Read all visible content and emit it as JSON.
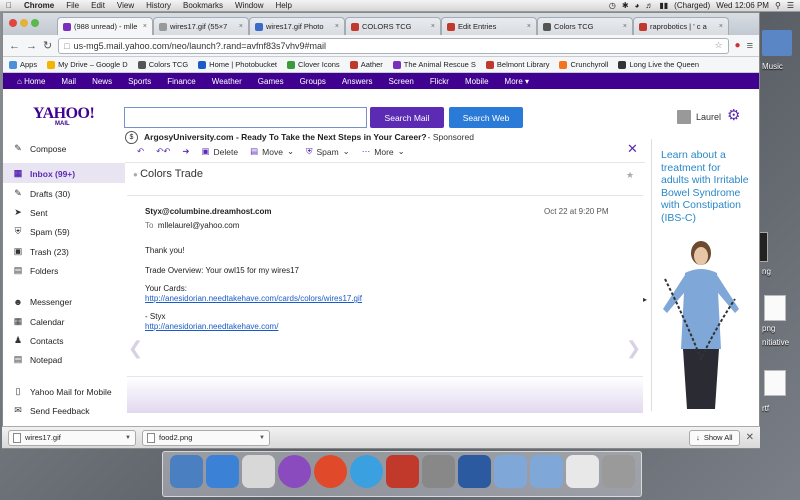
{
  "menubar": {
    "app_name": "Chrome",
    "items": [
      "File",
      "Edit",
      "View",
      "History",
      "Bookmarks",
      "Window",
      "Help"
    ],
    "battery": "(Charged)",
    "clock": "Wed 12:06 PM"
  },
  "desktop": {
    "icons": [
      "Music",
      "ng",
      "png",
      "nitiative",
      "rtf"
    ]
  },
  "tabs": [
    {
      "title": "(988 unread) - mlle",
      "active": true,
      "color": "#7b2fbf"
    },
    {
      "title": "wires17.gif (55×7",
      "active": false,
      "color": "#999999"
    },
    {
      "title": "wires17.gif Photo",
      "active": false,
      "color": "#3a6bc8"
    },
    {
      "title": "COLORS TCG",
      "active": false,
      "color": "#c0392b"
    },
    {
      "title": "Edit Entries",
      "active": false,
      "color": "#c0392b"
    },
    {
      "title": "Colors TCG",
      "active": false,
      "color": "#555555"
    },
    {
      "title": "raprobotics | ' c a",
      "active": false,
      "color": "#c0392b"
    }
  ],
  "omnibox": {
    "url": "us-mg5.mail.yahoo.com/neo/launch?.rand=avfnf83s7vhv9#mail"
  },
  "bookmarks": [
    {
      "label": "Apps",
      "color": "#4a90d9"
    },
    {
      "label": "My Drive – Google D",
      "color": "#f4b400"
    },
    {
      "label": "Colors TCG",
      "color": "#555555"
    },
    {
      "label": "Home | Photobucket",
      "color": "#1a5bc9"
    },
    {
      "label": "Clover Icons",
      "color": "#3a9b3a"
    },
    {
      "label": "Aather",
      "color": "#c0392b"
    },
    {
      "label": "The Animal Rescue S",
      "color": "#7b2fbf"
    },
    {
      "label": "Belmont Library",
      "color": "#c0392b"
    },
    {
      "label": "Crunchyroll",
      "color": "#f47521"
    },
    {
      "label": "Long Live the Queen",
      "color": "#333333"
    }
  ],
  "ynav": [
    "Home",
    "Mail",
    "News",
    "Sports",
    "Finance",
    "Weather",
    "Games",
    "Groups",
    "Answers",
    "Screen",
    "Flickr",
    "Mobile",
    "More ▾"
  ],
  "yheader": {
    "logo": "YAHOO!",
    "logo_sub": "MAIL",
    "search_placeholder": "",
    "search_mail": "Search Mail",
    "search_web": "Search Web",
    "user": "Laurel"
  },
  "sponsor": {
    "text": "ArgosyUniversity.com - Ready To Take the Next Steps in Your Career?",
    "tag": " - Sponsored"
  },
  "sidebar": {
    "compose": "Compose",
    "folders": [
      {
        "label": "Inbox (99+)",
        "icon": "inbox-icon"
      },
      {
        "label": "Drafts (30)",
        "icon": "drafts-icon"
      },
      {
        "label": "Sent",
        "icon": "sent-icon"
      },
      {
        "label": "Spam (59)",
        "icon": "spam-icon"
      },
      {
        "label": "Trash (23)",
        "icon": "trash-icon"
      },
      {
        "label": "Folders",
        "icon": "folder-icon"
      }
    ],
    "apps": [
      {
        "label": "Messenger",
        "icon": "messenger-icon"
      },
      {
        "label": "Calendar",
        "icon": "calendar-icon"
      },
      {
        "label": "Contacts",
        "icon": "contacts-icon"
      },
      {
        "label": "Notepad",
        "icon": "notepad-icon"
      }
    ],
    "extras": [
      {
        "label": "Yahoo Mail for Mobile",
        "icon": "mobile-icon"
      },
      {
        "label": "Send Feedback",
        "icon": "feedback-icon"
      }
    ]
  },
  "msgtoolbar": {
    "delete": "Delete",
    "move": "Move",
    "spam": "Spam",
    "more": "More"
  },
  "message": {
    "subject": "Colors Trade",
    "from": "Styx@columbine.dreamhost.com",
    "date": "Oct 22 at 9:20 PM",
    "to_label": "To",
    "to": "mllelaurel@yahoo.com",
    "greeting": "Thank you!",
    "overview": "Trade Overview: Your owl15 for my wires17",
    "cards_label": "Your Cards:",
    "cards_link": "http://anesidorian.needtakehave.com/cards/colors/wires17.gif",
    "signature": "- Styx",
    "sig_link": "http://anesidorian.needtakehave.com/"
  },
  "ad": {
    "text": "Learn about a treatment for adults with Irritable Bowel Syndrome with Constipation (IBS-C)"
  },
  "downloads": {
    "items": [
      "wires17.gif",
      "food2.png"
    ],
    "show_all": "Show All"
  },
  "dock": {
    "colors": [
      "#4a7fc1",
      "#3b82d6",
      "#d8d8d8",
      "#8a4bbf",
      "#e04a2a",
      "#3aa0e0",
      "#c0392b",
      "#888888",
      "#2c5aa0",
      "#7fa8d8",
      "#7fa8d8",
      "#e8e8e8",
      "#9a9a9a"
    ]
  }
}
